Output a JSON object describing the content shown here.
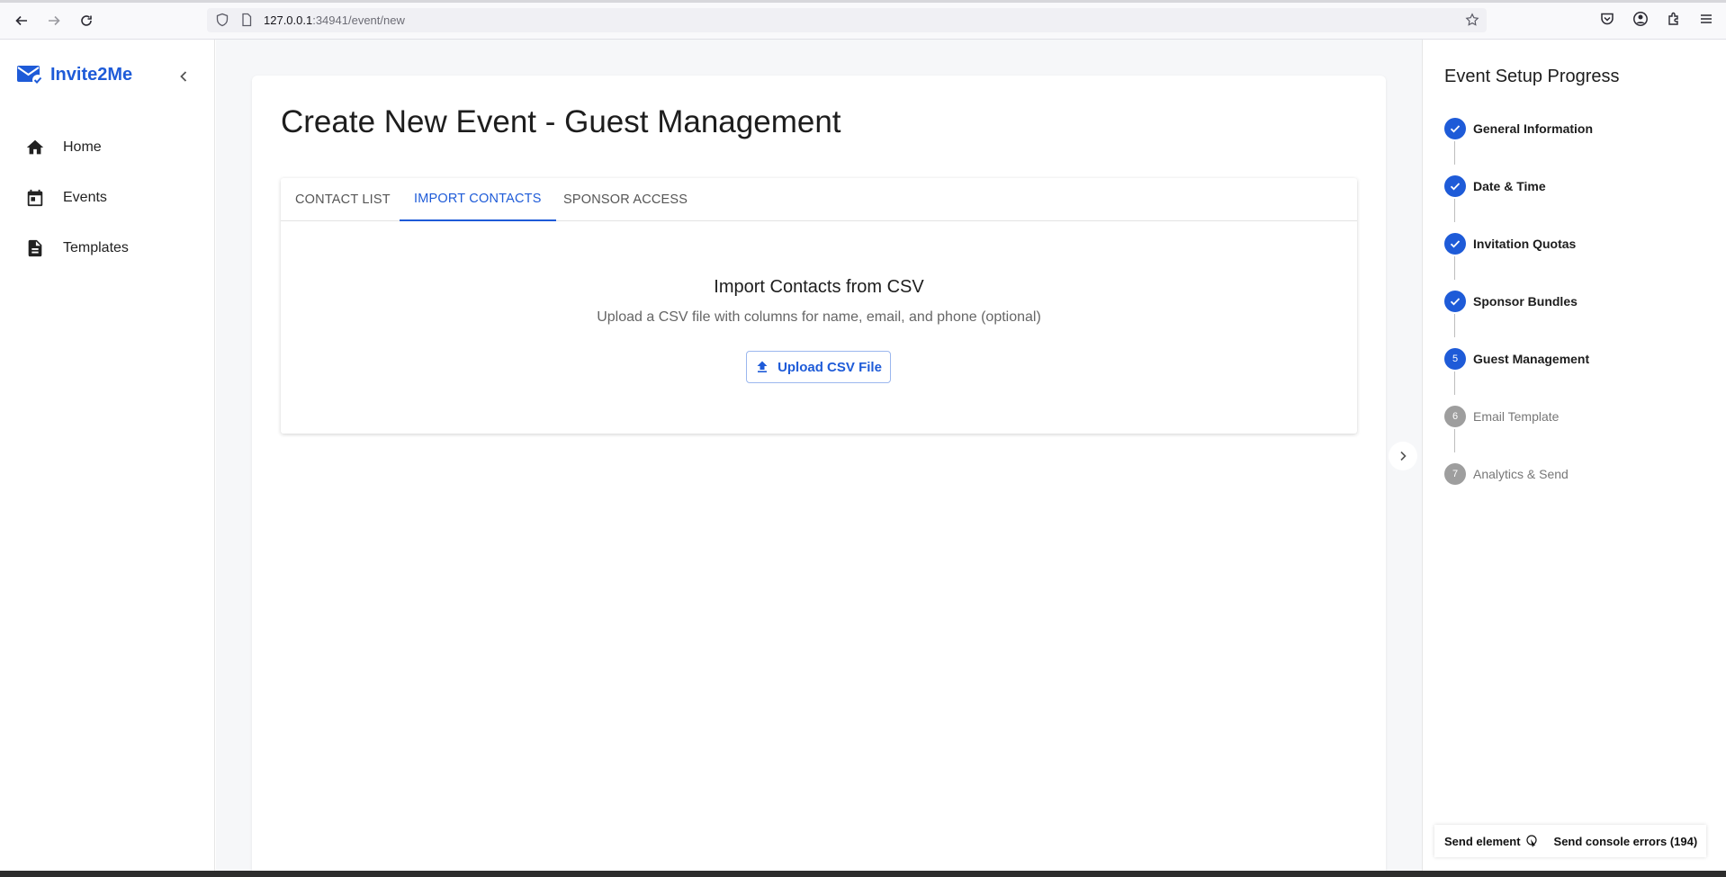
{
  "browser": {
    "url_host": "127.0.0.1",
    "url_path": ":34941/event/new"
  },
  "sidebar": {
    "brand": "Invite2Me",
    "items": [
      {
        "label": "Home",
        "icon": "home-icon"
      },
      {
        "label": "Events",
        "icon": "calendar-icon"
      },
      {
        "label": "Templates",
        "icon": "document-icon"
      }
    ]
  },
  "main": {
    "title": "Create New Event - Guest Management",
    "tabs": [
      {
        "label": "CONTACT LIST",
        "active": false
      },
      {
        "label": "IMPORT CONTACTS",
        "active": true
      },
      {
        "label": "SPONSOR ACCESS",
        "active": false
      }
    ],
    "import": {
      "title": "Import Contacts from CSV",
      "subtitle": "Upload a CSV file with columns for name, email, and phone (optional)",
      "button": "Upload CSV File"
    }
  },
  "progress": {
    "title": "Event Setup Progress",
    "steps": [
      {
        "number": "1",
        "label": "General Information",
        "status": "done"
      },
      {
        "number": "2",
        "label": "Date & Time",
        "status": "done"
      },
      {
        "number": "3",
        "label": "Invitation Quotas",
        "status": "done"
      },
      {
        "number": "4",
        "label": "Sponsor Bundles",
        "status": "done"
      },
      {
        "number": "5",
        "label": "Guest Management",
        "status": "current"
      },
      {
        "number": "6",
        "label": "Email Template",
        "status": "pending"
      },
      {
        "number": "7",
        "label": "Analytics & Send",
        "status": "pending"
      }
    ]
  },
  "devtools": {
    "send_element": "Send element",
    "send_console": "Send console errors (194)"
  },
  "colors": {
    "accent": "#1e5bd8",
    "pending": "#9e9e9e"
  }
}
